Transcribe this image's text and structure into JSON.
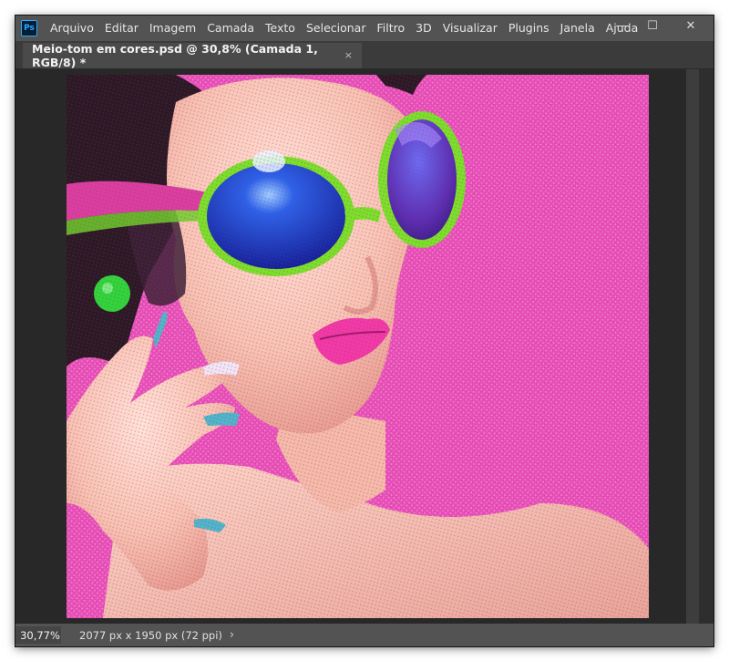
{
  "app": {
    "logo_text": "Ps",
    "menu": [
      "Arquivo",
      "Editar",
      "Imagem",
      "Camada",
      "Texto",
      "Selecionar",
      "Filtro",
      "3D",
      "Visualizar",
      "Plugins",
      "Janela",
      "Ajuda"
    ],
    "window_controls": {
      "minimize": "—",
      "restore": "☐",
      "close": "✕"
    }
  },
  "document": {
    "tab_title": "Meio-tom em cores.psd @ 30,8% (Camada 1, RGB/8) *",
    "tab_close": "×"
  },
  "status": {
    "zoom": "30,77%",
    "doc_info": "2077 px x 1950 px (72 ppi)",
    "arrow": "›"
  },
  "colors": {
    "background_magenta": "#e84fb8",
    "glasses_frame": "#7be02a",
    "lens_blue": "#1c3fd6",
    "lips": "#f03aa6",
    "earring": "#2fd63a",
    "nails": "#4fb6c9"
  }
}
